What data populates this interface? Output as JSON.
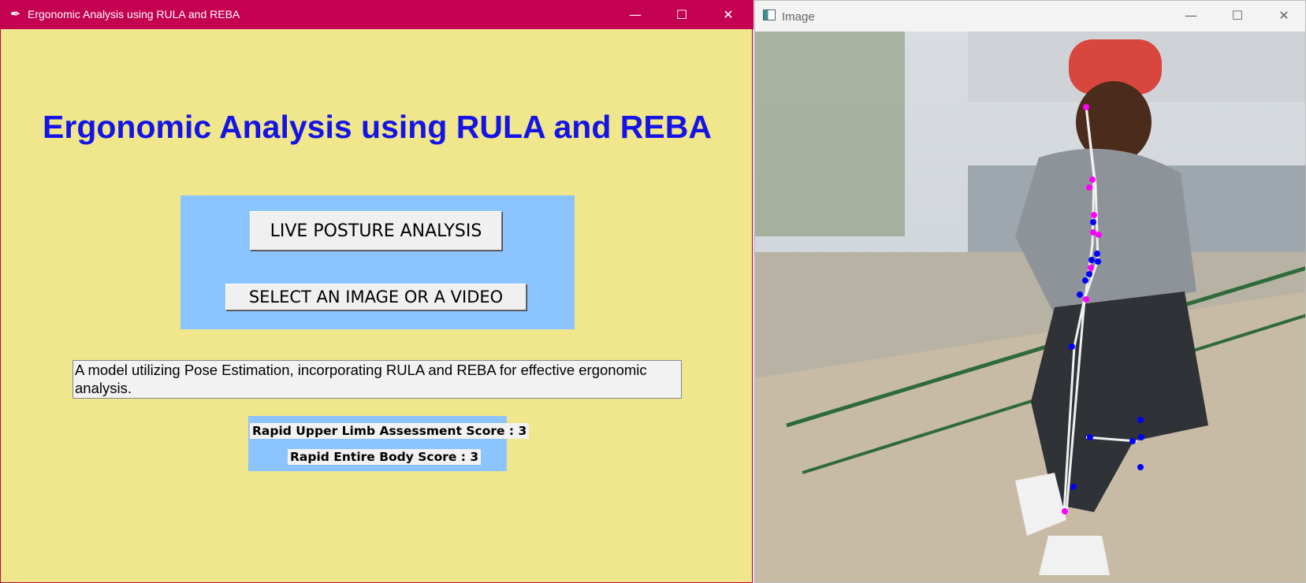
{
  "left_window": {
    "title": "Ergonomic Analysis using RULA and REBA",
    "heading": "Ergonomic Analysis using RULA and REBA",
    "buttons": {
      "live": "LIVE POSTURE ANALYSIS",
      "select": "SELECT AN IMAGE OR A VIDEO"
    },
    "description": "A model utilizing Pose Estimation, incorporating RULA and REBA for effective ergonomic analysis.",
    "scores": {
      "rula": "Rapid Upper Limb Assessment Score : 3",
      "reba": "Rapid Entire Body Score : 3"
    }
  },
  "right_window": {
    "title": "Image"
  },
  "window_controls": {
    "minimize": "—",
    "maximize": "☐",
    "close": "✕"
  },
  "colors": {
    "left_titlebar": "#c40050",
    "left_background": "#f0e68c",
    "heading": "#1414e6",
    "panel": "#8cc4ff",
    "keypoint_left": "#ff00ff",
    "keypoint_right": "#0000ff",
    "skeleton": "#f0f0f0"
  }
}
